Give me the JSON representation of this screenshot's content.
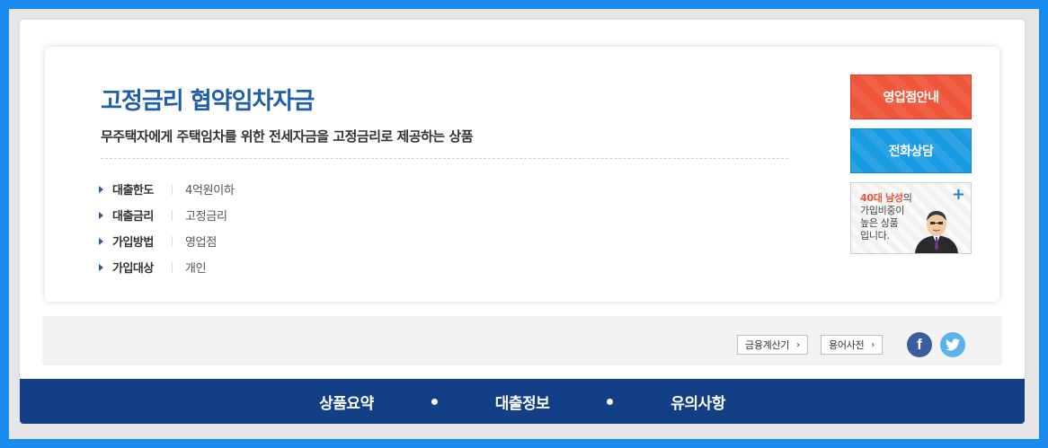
{
  "product": {
    "title": "고정금리 협약임차자금",
    "subtitle": "무주택자에게 주택임차를 위한 전세자금을 고정금리로 제공하는 상품",
    "info": [
      {
        "label": "대출한도",
        "value": "4억원이하"
      },
      {
        "label": "대출금리",
        "value": "고정금리"
      },
      {
        "label": "가입방법",
        "value": "영업점"
      },
      {
        "label": "가입대상",
        "value": "개인"
      }
    ]
  },
  "side": {
    "branch_label": "영업점안내",
    "phone_label": "전화상담",
    "stats": {
      "highlight": "40대 남성",
      "line1_rest": "의",
      "line2": "가입비중이",
      "line3": "높은 상품",
      "line4": "입니다.",
      "plus": "+"
    }
  },
  "tools": {
    "calc_label": "금융계산기",
    "dict_label": "용어사전",
    "chevron": "›",
    "facebook_glyph": "f"
  },
  "nav": {
    "items": [
      "상품요약",
      "대출정보",
      "유의사항"
    ]
  },
  "colors": {
    "title": "#1f5fa8",
    "branch_button": "#f0553a",
    "phone_button": "#199be3",
    "nav_background": "#123f86",
    "facebook": "#3b5c9e",
    "twitter": "#5ab2ea"
  },
  "icons": [
    "arrow-right-icon",
    "plus-icon",
    "person-avatar-icon",
    "chevron-right-icon",
    "facebook-icon",
    "twitter-icon"
  ]
}
